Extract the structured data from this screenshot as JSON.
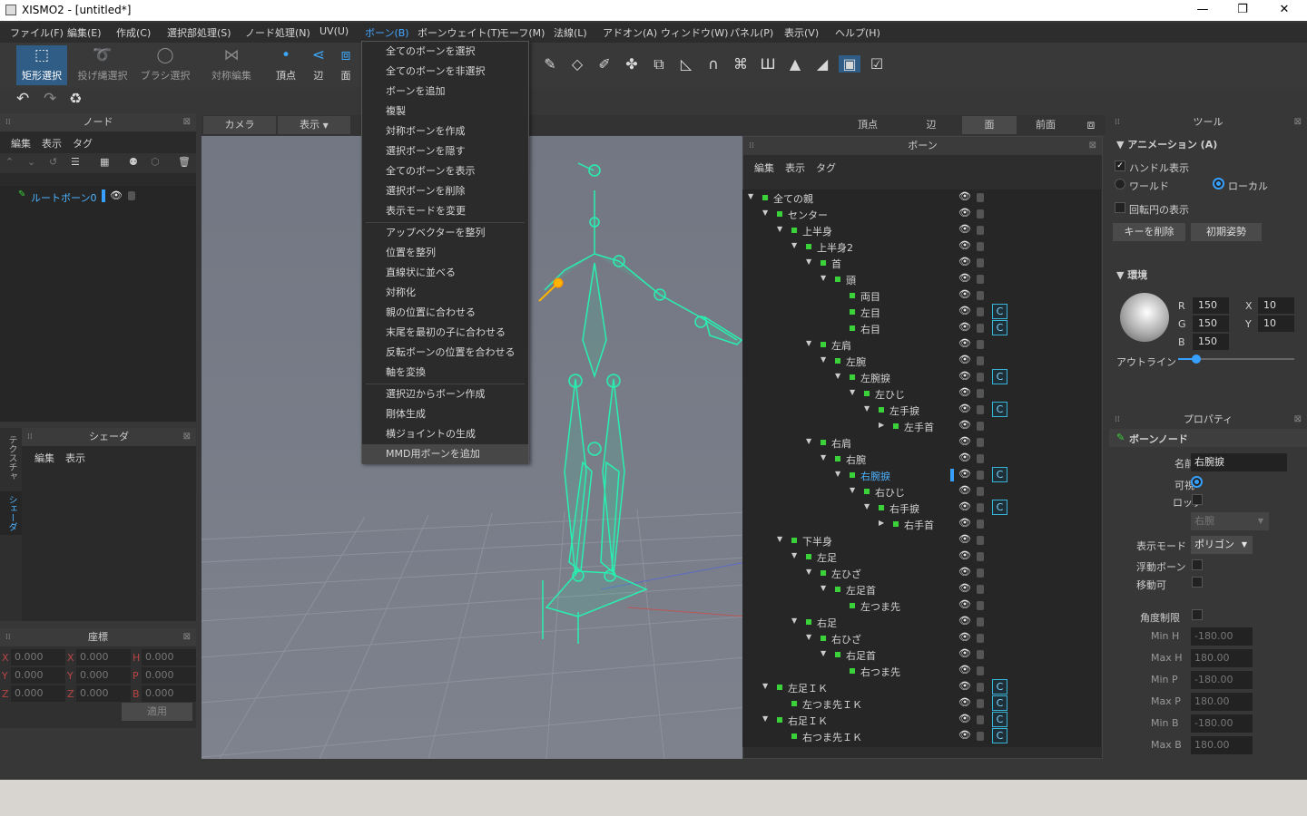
{
  "window": {
    "title": "XISMO2 - [untitled*]",
    "min": "—",
    "max": "❐",
    "close": "✕"
  },
  "menu": [
    "ファイル(F)",
    "編集(E)",
    "作成(C)",
    "選択部処理(S)",
    "ノード処理(N)",
    "UV(U)",
    "ボーン(B)",
    "ボーンウェイト(T)",
    "モーフ(M)",
    "法線(L)",
    "アドオン(A)",
    "ウィンドウ(W)",
    "パネル(P)",
    "表示(V)",
    "ヘルプ(H)"
  ],
  "toolbar": {
    "tools": [
      {
        "label": "矩形選択",
        "icon": "⬚"
      },
      {
        "label": "投げ縄選択",
        "icon": "➰"
      },
      {
        "label": "ブラシ選択",
        "icon": "◯"
      },
      {
        "label": "対称編集",
        "icon": "⋈"
      },
      {
        "label": "頂点",
        "icon": "•"
      },
      {
        "label": "辺",
        "icon": "⋖"
      },
      {
        "label": "面",
        "icon": "⧈"
      }
    ],
    "right_icons": [
      "✎",
      "◇",
      "✐",
      "✤",
      "⧉",
      "◺",
      "∩",
      "⌘",
      "Ш",
      "▲",
      "◢",
      "▣",
      "☑"
    ]
  },
  "undo": {
    "undo": "↶",
    "redo": "↷",
    "recycle": "♻"
  },
  "node_panel": {
    "title": "ノード",
    "menu": [
      "編集",
      "表示",
      "タグ"
    ],
    "icons": [
      "⌃",
      "⌄",
      "↺",
      "☰",
      "▦",
      "⚉",
      "⬡",
      "🗑"
    ],
    "root": "ルートボーン0"
  },
  "shader_panel": {
    "title": "シェーダ",
    "menu": [
      "編集",
      "表示"
    ],
    "side_tabs": [
      "テクスチャ",
      "シェーダ"
    ]
  },
  "coord_panel": {
    "title": "座標",
    "rows": [
      [
        [
          "X",
          "0.000"
        ],
        [
          "X",
          "0.000"
        ],
        [
          "H",
          "0.000"
        ]
      ],
      [
        [
          "Y",
          "0.000"
        ],
        [
          "Y",
          "0.000"
        ],
        [
          "P",
          "0.000"
        ]
      ],
      [
        [
          "Z",
          "0.000"
        ],
        [
          "Z",
          "0.000"
        ],
        [
          "B",
          "0.000"
        ]
      ]
    ],
    "apply": "適用"
  },
  "viewport": {
    "tabs_left": [
      "カメラ",
      "表示"
    ],
    "tabs_right": [
      "頂点",
      "辺",
      "面",
      "前面"
    ]
  },
  "bone_menu": {
    "items": [
      "全てのボーンを選択",
      "全てのボーンを非選択",
      "ボーンを追加",
      "複製",
      "対称ボーンを作成",
      "選択ボーンを隠す",
      "全てのボーンを表示",
      "選択ボーンを削除",
      "表示モードを変更",
      "アップベクターを整列",
      "位置を整列",
      "直線状に並べる",
      "対称化",
      "親の位置に合わせる",
      "末尾を最初の子に合わせる",
      "反転ボーンの位置を合わせる",
      "軸を変換",
      "選択辺からボーン作成",
      "剛体生成",
      "横ジョイントの生成",
      "MMD用ボーンを追加"
    ]
  },
  "bone_panel": {
    "title": "ボーン",
    "menu": [
      "編集",
      "表示",
      "タグ"
    ],
    "eye": "👁",
    "c": "C",
    "tree": [
      {
        "label": "全ての親",
        "depth": 0,
        "arrow": "▼",
        "c": false
      },
      {
        "label": "センター",
        "depth": 1,
        "arrow": "▼",
        "c": false
      },
      {
        "label": "上半身",
        "depth": 2,
        "arrow": "▼",
        "c": false
      },
      {
        "label": "上半身2",
        "depth": 3,
        "arrow": "▼",
        "c": false
      },
      {
        "label": "首",
        "depth": 4,
        "arrow": "▼",
        "c": false
      },
      {
        "label": "頭",
        "depth": 5,
        "arrow": "▼",
        "c": false
      },
      {
        "label": "両目",
        "depth": 6,
        "arrow": "",
        "c": false
      },
      {
        "label": "左目",
        "depth": 6,
        "arrow": "",
        "c": true
      },
      {
        "label": "右目",
        "depth": 6,
        "arrow": "",
        "c": true
      },
      {
        "label": "左肩",
        "depth": 4,
        "arrow": "▼",
        "c": false
      },
      {
        "label": "左腕",
        "depth": 5,
        "arrow": "▼",
        "c": false
      },
      {
        "label": "左腕捩",
        "depth": 6,
        "arrow": "▼",
        "c": true
      },
      {
        "label": "左ひじ",
        "depth": 7,
        "arrow": "▼",
        "c": false
      },
      {
        "label": "左手捩",
        "depth": 8,
        "arrow": "▼",
        "c": true
      },
      {
        "label": "左手首",
        "depth": 9,
        "arrow": "▶",
        "c": false
      },
      {
        "label": "右肩",
        "depth": 4,
        "arrow": "▼",
        "c": false
      },
      {
        "label": "右腕",
        "depth": 5,
        "arrow": "▼",
        "c": false
      },
      {
        "label": "右腕捩",
        "depth": 6,
        "arrow": "▼",
        "c": true,
        "sel": true
      },
      {
        "label": "右ひじ",
        "depth": 7,
        "arrow": "▼",
        "c": false
      },
      {
        "label": "右手捩",
        "depth": 8,
        "arrow": "▼",
        "c": true
      },
      {
        "label": "右手首",
        "depth": 9,
        "arrow": "▶",
        "c": false
      },
      {
        "label": "下半身",
        "depth": 2,
        "arrow": "▼",
        "c": false
      },
      {
        "label": "左足",
        "depth": 3,
        "arrow": "▼",
        "c": false
      },
      {
        "label": "左ひざ",
        "depth": 4,
        "arrow": "▼",
        "c": false
      },
      {
        "label": "左足首",
        "depth": 5,
        "arrow": "▼",
        "c": false
      },
      {
        "label": "左つま先",
        "depth": 6,
        "arrow": "",
        "c": false
      },
      {
        "label": "右足",
        "depth": 3,
        "arrow": "▼",
        "c": false
      },
      {
        "label": "右ひざ",
        "depth": 4,
        "arrow": "▼",
        "c": false
      },
      {
        "label": "右足首",
        "depth": 5,
        "arrow": "▼",
        "c": false
      },
      {
        "label": "右つま先",
        "depth": 6,
        "arrow": "",
        "c": false
      },
      {
        "label": "左足ＩＫ",
        "depth": 1,
        "arrow": "▼",
        "c": true
      },
      {
        "label": "左つま先ＩＫ",
        "depth": 2,
        "arrow": "",
        "c": true
      },
      {
        "label": "右足ＩＫ",
        "depth": 1,
        "arrow": "▼",
        "c": true
      },
      {
        "label": "右つま先ＩＫ",
        "depth": 2,
        "arrow": "",
        "c": true
      }
    ]
  },
  "tool_panel": {
    "title": "ツール",
    "animation_header": "アニメーション (A)",
    "handle_display": "ハンドル表示",
    "world": "ワールド",
    "local": "ローカル",
    "rotation_circle": "回転円の表示",
    "delete_key": "キーを削除",
    "initial_pose": "初期姿勢",
    "env_header": "環境",
    "r_label": "R",
    "g_label": "G",
    "b_label": "B",
    "r": "150",
    "g": "150",
    "b": "150",
    "x_label": "X",
    "y_label": "Y",
    "x": "10",
    "y": "10",
    "outline": "アウトライン",
    "outline_level": 0.16
  },
  "property_panel": {
    "title": "プロパティ",
    "header": "ボーンノード",
    "name_label": "名前",
    "name_value": "右腕捩",
    "visible": "可視",
    "lock": "ロック",
    "parent_value": "右腕",
    "display_mode": "表示モード",
    "display_value": "ポリゴン",
    "floating": "浮動ボーン",
    "movable": "移動可",
    "angle_limit": "角度制限",
    "limits": [
      [
        "Min H",
        "-180.00"
      ],
      [
        "Max H",
        "180.00"
      ],
      [
        "Min P",
        "-180.00"
      ],
      [
        "Max P",
        "180.00"
      ],
      [
        "Min B",
        "-180.00"
      ],
      [
        "Max B",
        "180.00"
      ]
    ]
  }
}
